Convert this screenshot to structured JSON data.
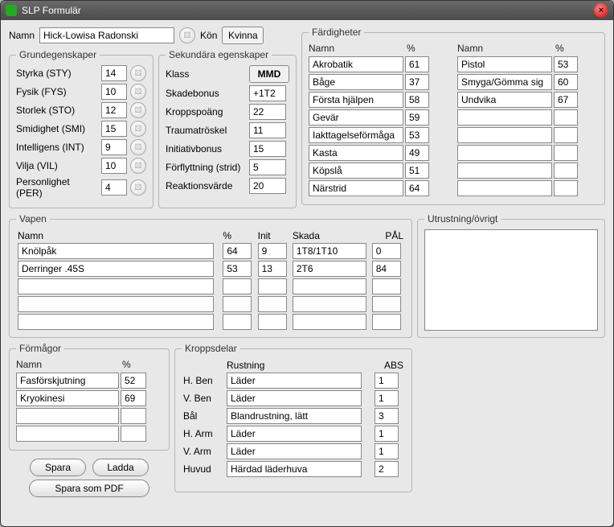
{
  "window": {
    "title": "SLP Formulär"
  },
  "name_label": "Namn",
  "name_value": "Hick-Lowisa Radonski",
  "gender_label": "Kön",
  "gender_value": "Kvinna",
  "grund": {
    "legend": "Grundegenskaper",
    "rows": [
      {
        "label": "Styrka (STY)",
        "value": "14"
      },
      {
        "label": "Fysik (FYS)",
        "value": "10"
      },
      {
        "label": "Storlek (STO)",
        "value": "12"
      },
      {
        "label": "Smidighet (SMI)",
        "value": "15"
      },
      {
        "label": "Intelligens (INT)",
        "value": "9"
      },
      {
        "label": "Vilja (VIL)",
        "value": "10"
      },
      {
        "label": "Personlighet (PER)",
        "value": "4"
      }
    ]
  },
  "sek": {
    "legend": "Sekundära egenskaper",
    "rows": [
      {
        "label": "Klass",
        "value": "MMD",
        "button": true
      },
      {
        "label": "Skadebonus",
        "value": "+1T2"
      },
      {
        "label": "Kroppspoäng",
        "value": "22"
      },
      {
        "label": "Traumatröskel",
        "value": "11"
      },
      {
        "label": "Initiativbonus",
        "value": "15"
      },
      {
        "label": "Förflyttning (strid)",
        "value": "5"
      },
      {
        "label": "Reaktionsvärde",
        "value": "20"
      }
    ]
  },
  "fard": {
    "legend": "Färdigheter",
    "name_header": "Namn",
    "pct_header": "%",
    "left": [
      {
        "name": "Akrobatik",
        "pct": "61"
      },
      {
        "name": "Båge",
        "pct": "37"
      },
      {
        "name": "Första hjälpen",
        "pct": "58"
      },
      {
        "name": "Gevär",
        "pct": "59"
      },
      {
        "name": "Iakttagelseförmåga",
        "pct": "53"
      },
      {
        "name": "Kasta",
        "pct": "49"
      },
      {
        "name": "Köpslå",
        "pct": "51"
      },
      {
        "name": "Närstrid",
        "pct": "64"
      }
    ],
    "right": [
      {
        "name": "Pistol",
        "pct": "53"
      },
      {
        "name": "Smyga/Gömma sig",
        "pct": "60"
      },
      {
        "name": "Undvika",
        "pct": "67"
      },
      {
        "name": "",
        "pct": ""
      },
      {
        "name": "",
        "pct": ""
      },
      {
        "name": "",
        "pct": ""
      },
      {
        "name": "",
        "pct": ""
      },
      {
        "name": "",
        "pct": ""
      }
    ]
  },
  "vapen": {
    "legend": "Vapen",
    "headers": {
      "name": "Namn",
      "pct": "%",
      "init": "Init",
      "skada": "Skada",
      "pal": "PÅL"
    },
    "rows": [
      {
        "name": "Knölpåk",
        "pct": "64",
        "init": "9",
        "skada": "1T8/1T10",
        "pal": "0"
      },
      {
        "name": "Derringer .45S",
        "pct": "53",
        "init": "13",
        "skada": "2T6",
        "pal": "84"
      },
      {
        "name": "",
        "pct": "",
        "init": "",
        "skada": "",
        "pal": ""
      },
      {
        "name": "",
        "pct": "",
        "init": "",
        "skada": "",
        "pal": ""
      },
      {
        "name": "",
        "pct": "",
        "init": "",
        "skada": "",
        "pal": ""
      }
    ]
  },
  "utrust": {
    "legend": "Utrustning/övrigt",
    "value": ""
  },
  "form": {
    "legend": "Förmågor",
    "headers": {
      "name": "Namn",
      "pct": "%"
    },
    "rows": [
      {
        "name": "Fasförskjutning",
        "pct": "52"
      },
      {
        "name": "Kryokinesi",
        "pct": "69"
      },
      {
        "name": "",
        "pct": ""
      },
      {
        "name": "",
        "pct": ""
      }
    ]
  },
  "kropp": {
    "legend": "Kroppsdelar",
    "headers": {
      "rust": "Rustning",
      "abs": "ABS"
    },
    "rows": [
      {
        "label": "H. Ben",
        "rust": "Läder",
        "abs": "1"
      },
      {
        "label": "V. Ben",
        "rust": "Läder",
        "abs": "1"
      },
      {
        "label": "Bål",
        "rust": "Blandrustning, lätt",
        "abs": "3"
      },
      {
        "label": "H. Arm",
        "rust": "Läder",
        "abs": "1"
      },
      {
        "label": "V. Arm",
        "rust": "Läder",
        "abs": "1"
      },
      {
        "label": "Huvud",
        "rust": "Härdad läderhuva",
        "abs": "2"
      }
    ]
  },
  "buttons": {
    "save": "Spara",
    "load": "Ladda",
    "pdf": "Spara som PDF"
  }
}
